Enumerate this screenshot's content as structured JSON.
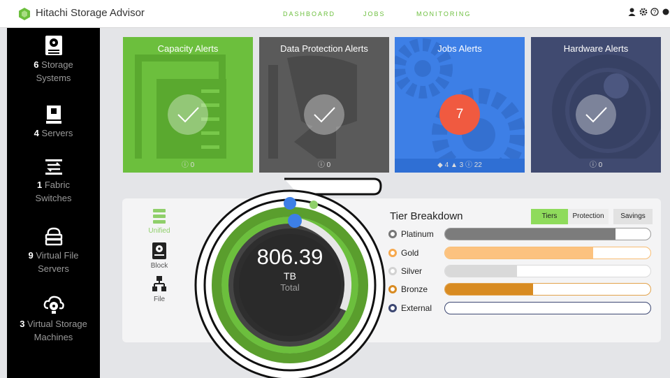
{
  "app": {
    "title": "Hitachi Storage Advisor"
  },
  "nav": {
    "items": [
      "DASHBOARD",
      "JOBS",
      "MONITORING"
    ]
  },
  "sidebar": {
    "items": [
      {
        "count": "6",
        "label_line1": "Storage",
        "label_line2": "Systems",
        "icon": "storage-system-icon"
      },
      {
        "count": "4",
        "label_line1": "Servers",
        "label_line2": "",
        "icon": "server-icon"
      },
      {
        "count": "1",
        "label_line1": "Fabric",
        "label_line2": "Switches",
        "icon": "fabric-switch-icon"
      },
      {
        "count": "9",
        "label_line1": "Virtual File",
        "label_line2": "Servers",
        "icon": "virtual-file-server-icon"
      },
      {
        "count": "3",
        "label_line1": "Virtual Storage",
        "label_line2": "Machines",
        "icon": "virtual-storage-machine-icon"
      }
    ]
  },
  "alerts": [
    {
      "title": "Capacity Alerts",
      "footer": "0",
      "color": "#6cbf3d",
      "status": "ok"
    },
    {
      "title": "Data Protection Alerts",
      "footer": "0",
      "color": "#5a5a5a",
      "status": "ok"
    },
    {
      "title": "Jobs Alerts",
      "badge": "7",
      "footer_counts": [
        "4",
        "3",
        "22"
      ],
      "color": "#3d7fe6",
      "status": "alert"
    },
    {
      "title": "Hardware Alerts",
      "footer": "0",
      "color": "#404a70",
      "status": "ok"
    }
  ],
  "storage_types": [
    {
      "label": "Unified",
      "icon": "unified-icon",
      "active": true
    },
    {
      "label": "Block",
      "icon": "block-icon",
      "active": false
    },
    {
      "label": "File",
      "icon": "file-icon",
      "active": false
    }
  ],
  "total": {
    "value": "806.39",
    "unit": "TB",
    "label": "Total"
  },
  "tier_breakdown": {
    "title": "Tier Breakdown",
    "tabs": [
      "Tiers",
      "Protection",
      "Savings"
    ],
    "active_tab": "Tiers",
    "tiers": [
      {
        "name": "Platinum",
        "fraction": 0.83,
        "color": "#7c7c7c"
      },
      {
        "name": "Gold",
        "fraction": 0.72,
        "color": "#fcc27f"
      },
      {
        "name": "Silver",
        "fraction": 0.35,
        "color": "#d9d9d9"
      },
      {
        "name": "Bronze",
        "fraction": 0.43,
        "color": "#d88b22"
      },
      {
        "name": "External",
        "fraction": 0.0,
        "color": "#3c4772"
      }
    ]
  },
  "colors": {
    "accent": "#6cbf3d",
    "sidebar_bg": "#000000"
  }
}
